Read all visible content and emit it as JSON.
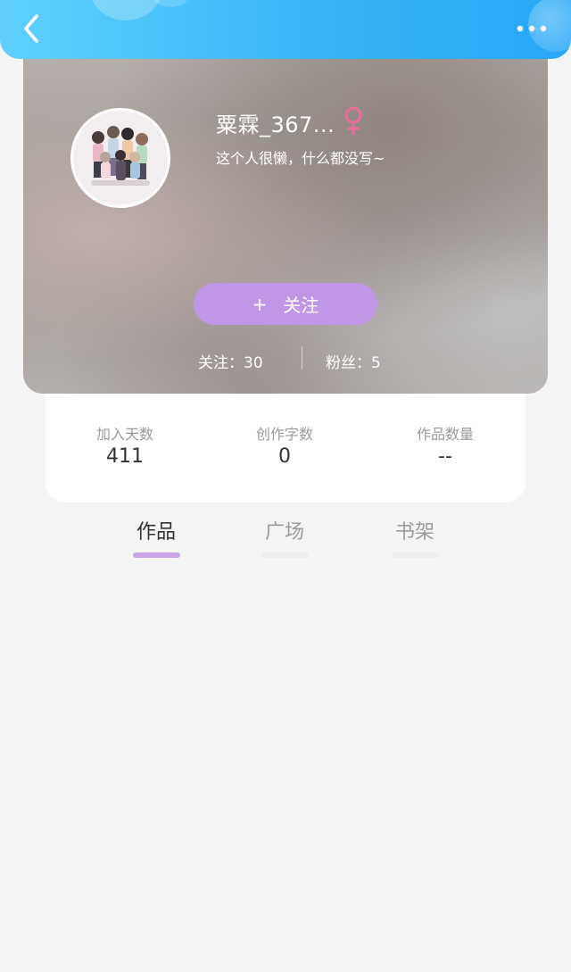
{
  "nav": {
    "back_icon": "chevron-left-icon",
    "more_icon": "more-dots-icon",
    "accent_color": "#38b6f8"
  },
  "profile": {
    "username": "粟霖_367...",
    "gender_icon": "female-icon",
    "gender_color": "#e86f9a",
    "bio": "这个人很懒，什么都没写~",
    "follow_button": {
      "plus": "+",
      "label": "关注",
      "color": "#bf97e6"
    },
    "following": "关注：30",
    "fans": "粉丝：5"
  },
  "stats": [
    {
      "label": "加入天数",
      "value": "411"
    },
    {
      "label": "创作字数",
      "value": "0"
    },
    {
      "label": "作品数量",
      "value": "--"
    }
  ],
  "tabs": [
    {
      "label": "作品",
      "active": true
    },
    {
      "label": "广场",
      "active": false
    },
    {
      "label": "书架",
      "active": false
    }
  ]
}
